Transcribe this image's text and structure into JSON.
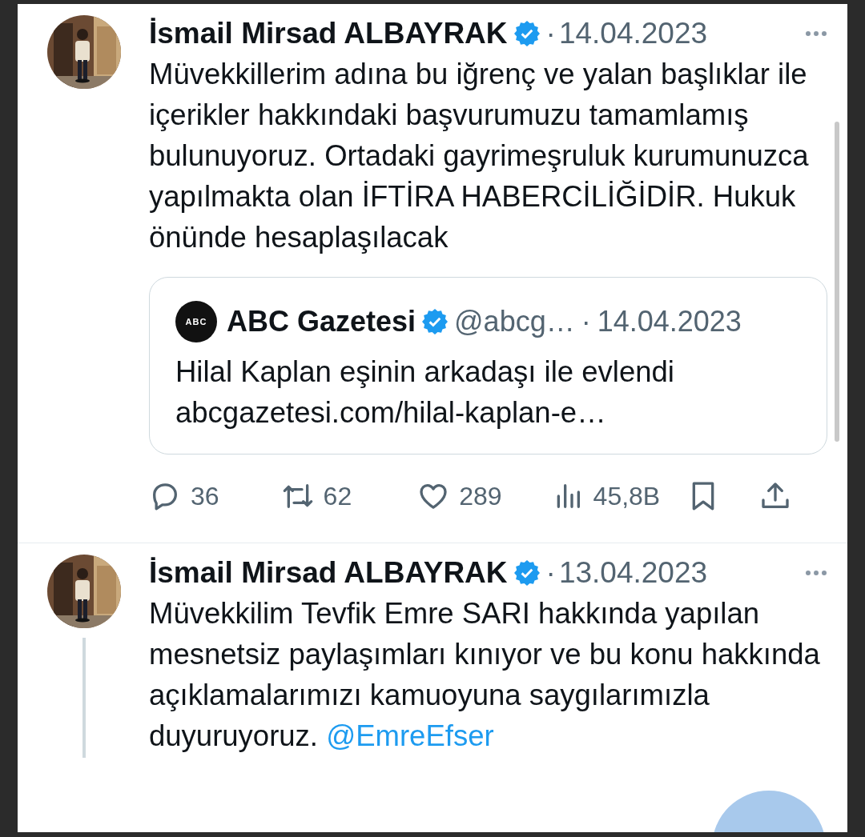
{
  "tweets": [
    {
      "author": "İsmail Mirsad ALBAYRAK",
      "verified": true,
      "separator": "·",
      "date": "14.04.2023",
      "text": "Müvekkillerim adına bu iğrenç ve yalan başlıklar ile içerikler hakkındaki başvurumuzu tamamlamış bulunuyoruz. Ortadaki gayrimeşruluk kurumunuzca yapılmakta olan İFTİRA HABERCİLİĞİDİR. Hukuk önünde hesaplaşılacak",
      "thread_line": false,
      "quote": {
        "logo_text": "ABC",
        "name": "ABC Gazetesi",
        "verified": true,
        "handle": "@abcg…",
        "separator": "·",
        "date": "14.04.2023",
        "text": "Hilal Kaplan eşinin arkadaşı ile evlendi",
        "link": "abcgazetesi.com/hilal-kaplan-e…"
      },
      "actions": [
        {
          "kind": "reply",
          "count": "36"
        },
        {
          "kind": "retweet",
          "count": "62"
        },
        {
          "kind": "like",
          "count": "289"
        },
        {
          "kind": "views",
          "count": "45,8B"
        },
        {
          "kind": "bookmark"
        },
        {
          "kind": "share"
        }
      ]
    },
    {
      "author": "İsmail Mirsad ALBAYRAK",
      "verified": true,
      "separator": "·",
      "date": "13.04.2023",
      "text": "Müvekkilim Tevfik Emre SARI hakkında yapılan mesnetsiz paylaşımları kınıyor ve bu konu hakkında açıklamalarımızı kamuoyuna saygılarımızla duyuruyoruz.",
      "mention": "@EmreEfser",
      "thread_line": true
    }
  ]
}
